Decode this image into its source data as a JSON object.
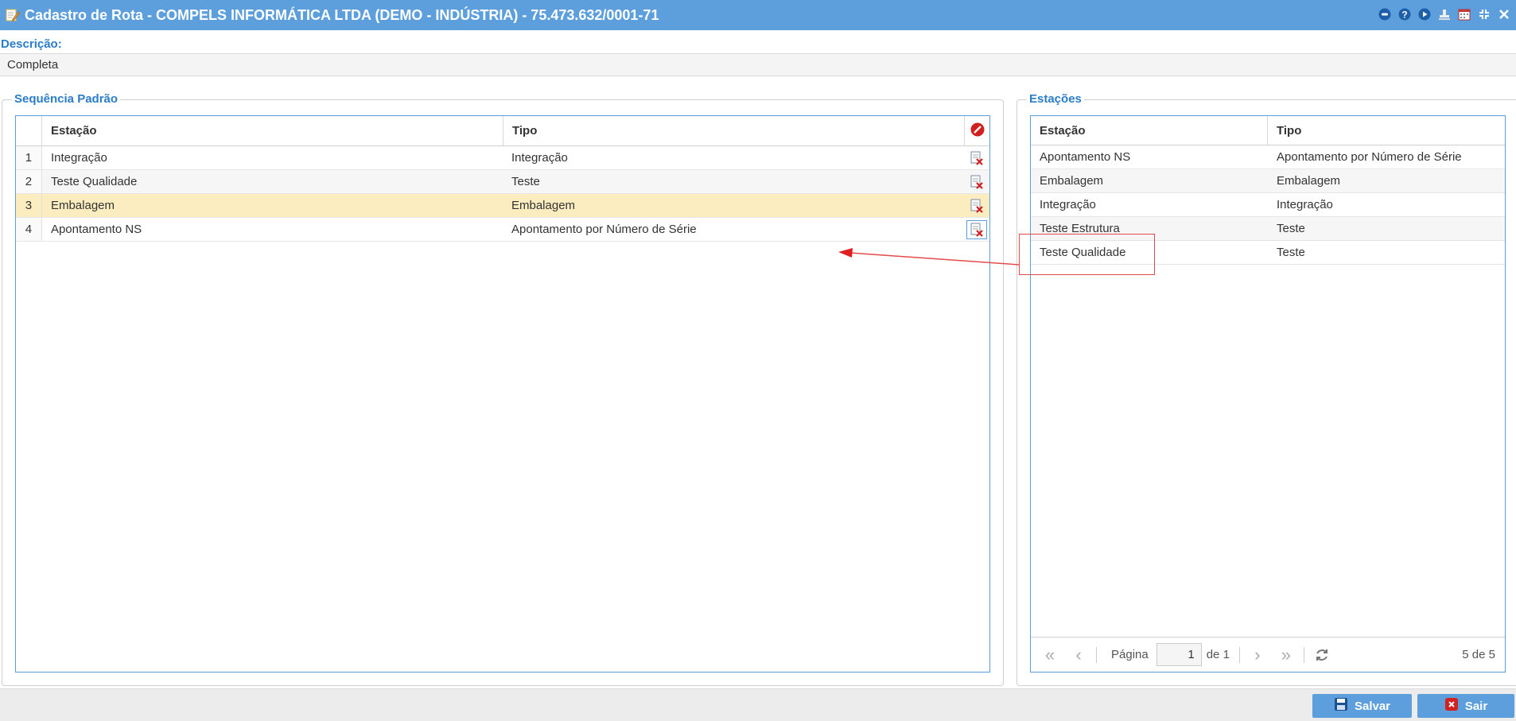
{
  "window": {
    "title": "Cadastro de Rota - COMPELS INFORMÁTICA LTDA (DEMO - INDÚSTRIA) - 75.473.632/0001-71",
    "tools": [
      "info-icon",
      "help-icon",
      "play-icon",
      "stamp-icon",
      "calendar-icon",
      "collapse-icon",
      "close-icon"
    ]
  },
  "descricao": {
    "label": "Descrição:",
    "value": "Completa"
  },
  "sequencia": {
    "legend": "Sequência Padrão",
    "columns": {
      "estacao": "Estação",
      "tipo": "Tipo"
    },
    "rows": [
      {
        "num": "1",
        "estacao": "Integração",
        "tipo": "Integração"
      },
      {
        "num": "2",
        "estacao": "Teste Qualidade",
        "tipo": "Teste"
      },
      {
        "num": "3",
        "estacao": "Embalagem",
        "tipo": "Embalagem"
      },
      {
        "num": "4",
        "estacao": "Apontamento NS",
        "tipo": "Apontamento por Número de Série"
      }
    ]
  },
  "estacoes": {
    "legend": "Estações",
    "columns": {
      "estacao": "Estação",
      "tipo": "Tipo"
    },
    "rows": [
      {
        "estacao": "Apontamento NS",
        "tipo": "Apontamento por Número de Série"
      },
      {
        "estacao": "Embalagem",
        "tipo": "Embalagem"
      },
      {
        "estacao": "Integração",
        "tipo": "Integração"
      },
      {
        "estacao": "Teste Estrutura",
        "tipo": "Teste"
      },
      {
        "estacao": "Teste Qualidade",
        "tipo": "Teste"
      }
    ],
    "pager": {
      "page_label": "Página",
      "page": "1",
      "of_label": "de 1",
      "summary": "5 de 5"
    }
  },
  "footer": {
    "save_label": "Salvar",
    "exit_label": "Sair"
  },
  "colors": {
    "accent": "#5c9fdc",
    "label": "#2b7cc9",
    "selected_row": "#fbedc0",
    "annotation": "#e24b4b"
  }
}
